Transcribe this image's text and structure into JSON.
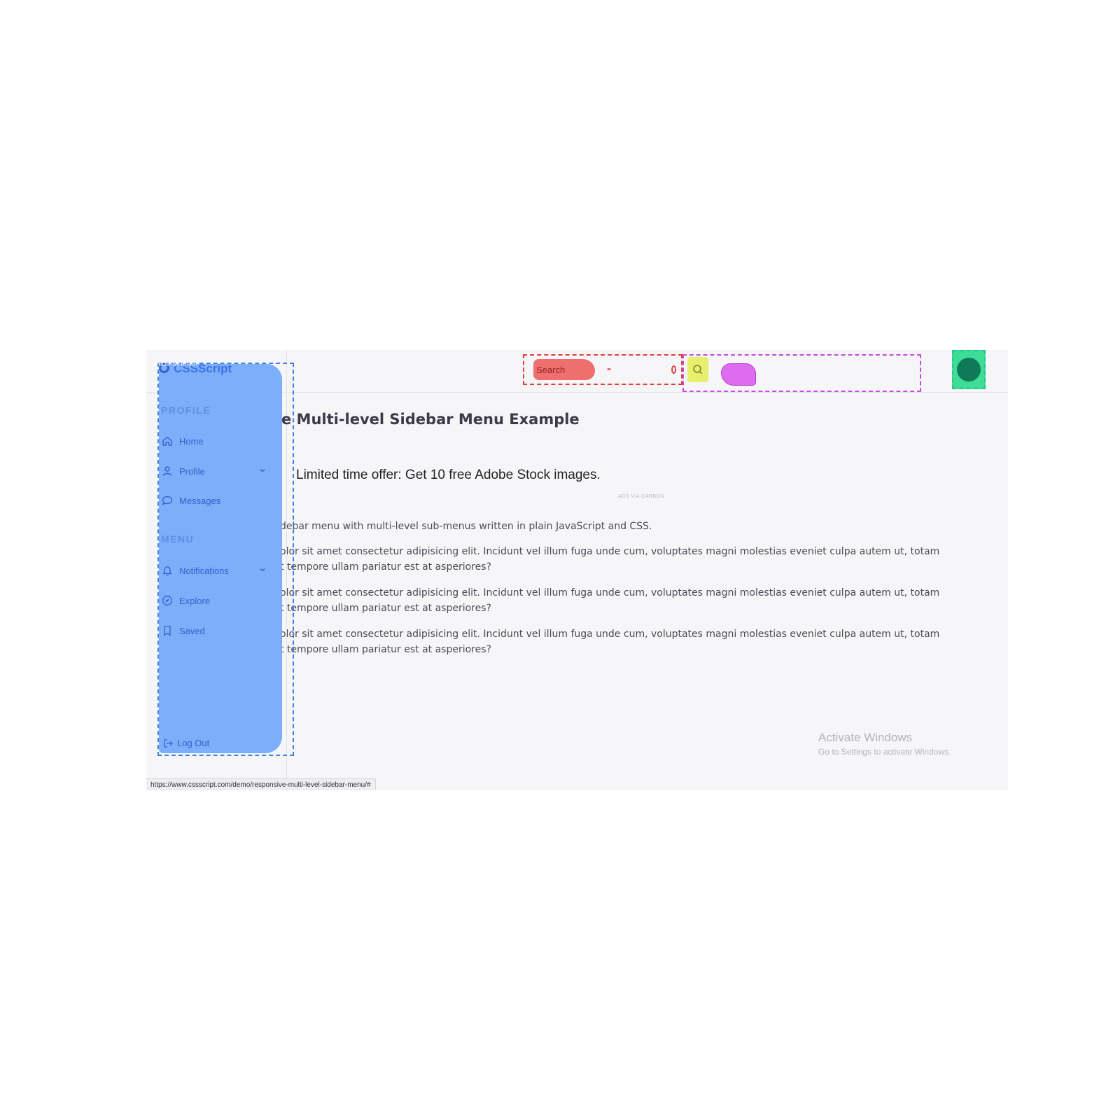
{
  "brand": {
    "name": "CSSScript",
    "overlay_text": "Hide sidebar"
  },
  "header": {
    "search_placeholder": "Search",
    "minus_glyph": "-"
  },
  "sidebar": {
    "sections": [
      {
        "label": "PROFILE",
        "items": [
          {
            "label": "Home",
            "icon": "home-icon",
            "has_submenu": false
          },
          {
            "label": "Profile",
            "icon": "user-icon",
            "has_submenu": true
          },
          {
            "label": "Messages",
            "icon": "message-icon",
            "has_submenu": false
          }
        ]
      },
      {
        "label": "MENU",
        "items": [
          {
            "label": "Notifications",
            "icon": "bell-icon",
            "has_submenu": true
          },
          {
            "label": "Explore",
            "icon": "compass-icon",
            "has_submenu": false
          },
          {
            "label": "Saved",
            "icon": "bookmark-icon",
            "has_submenu": false
          }
        ]
      }
    ],
    "logout_label": "Log Out"
  },
  "main": {
    "title": "e Multi-level Sidebar Menu Example",
    "ad_text": "Limited time offer: Get 10 free Adobe Stock images.",
    "ad_credit": "ADS VIA CARBON",
    "intro": "debar menu with multi-level sub-menus written in plain JavaScript and CSS.",
    "paragraphs": [
      "olor sit amet consectetur adipisicing elit. Incidunt vel illum fuga unde cum, voluptates magni molestias eveniet culpa autem ut, totam\nt tempore ullam pariatur est at asperiores?",
      "olor sit amet consectetur adipisicing elit. Incidunt vel illum fuga unde cum, voluptates magni molestias eveniet culpa autem ut, totam\nt tempore ullam pariatur est at asperiores?",
      "olor sit amet consectetur adipisicing elit. Incidunt vel illum fuga unde cum, voluptates magni molestias eveniet culpa autem ut, totam\nt tempore ullam pariatur est at asperiores?"
    ]
  },
  "watermark": {
    "title": "Activate Windows",
    "subtitle": "Go to Settings to activate Windows."
  },
  "status_bar": {
    "url": "https://www.cssscript.com/demo/responsive-multi-level-sidebar-menu/#"
  },
  "colors": {
    "sidebar_highlight": "#7daef9",
    "search_highlight": "#ef6f6f",
    "button_highlight": "#e8ef6a",
    "action_highlight": "#df6cf0",
    "avatar_highlight": "#3ddd97"
  }
}
